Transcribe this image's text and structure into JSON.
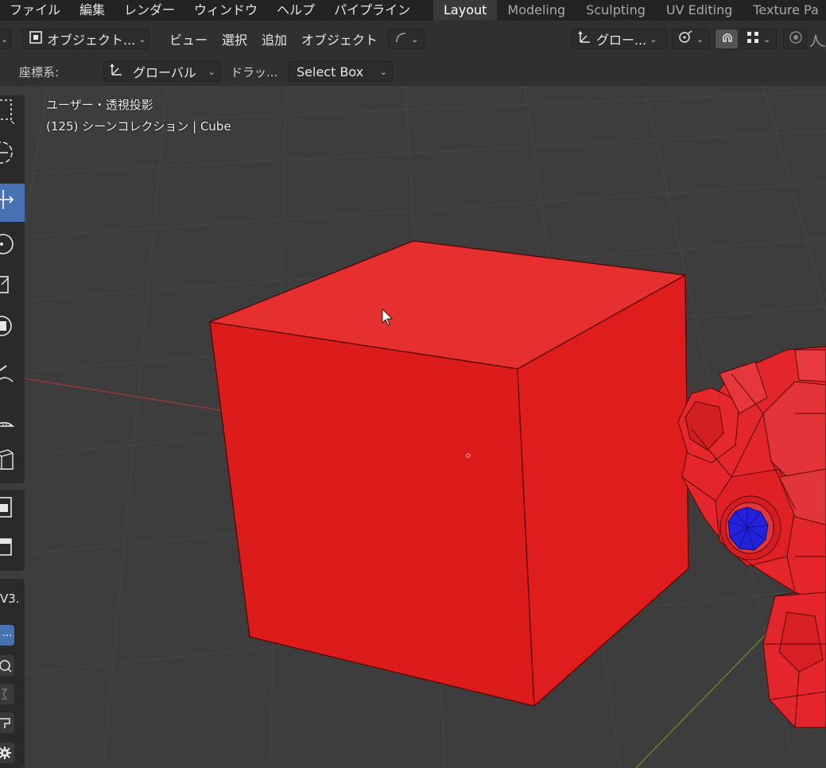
{
  "menubar": {
    "items": [
      "ファイル",
      "編集",
      "レンダー",
      "ウィンドウ",
      "ヘルプ",
      "パイプライン"
    ]
  },
  "workspace_tabs": [
    {
      "label": "Layout",
      "active": true
    },
    {
      "label": "Modeling",
      "active": false
    },
    {
      "label": "Sculpting",
      "active": false
    },
    {
      "label": "UV Editing",
      "active": false
    },
    {
      "label": "Texture Pa",
      "active": false
    }
  ],
  "view_header": {
    "mode_label": "オブジェクト...",
    "menus": [
      "ビュー",
      "選択",
      "追加",
      "オブジェクト"
    ],
    "orientation_label": "グロー..."
  },
  "tool_settings": {
    "coord_label": "座標系:",
    "coord_value": "グローバル",
    "drag_label": "ドラッ...",
    "drag_value": "Select Box"
  },
  "viewport": {
    "view_name": "ユーザー・透視投影",
    "scene_info": "(125) シーンコレクション | Cube"
  },
  "toolbar": {
    "version_fragment": "V3.",
    "ellipsis": "..."
  },
  "colors": {
    "cube_red": "#dd1a1a",
    "monkey_red": "#e3262b",
    "eye_blue": "#2222dd",
    "active_tool": "#4772b3"
  }
}
